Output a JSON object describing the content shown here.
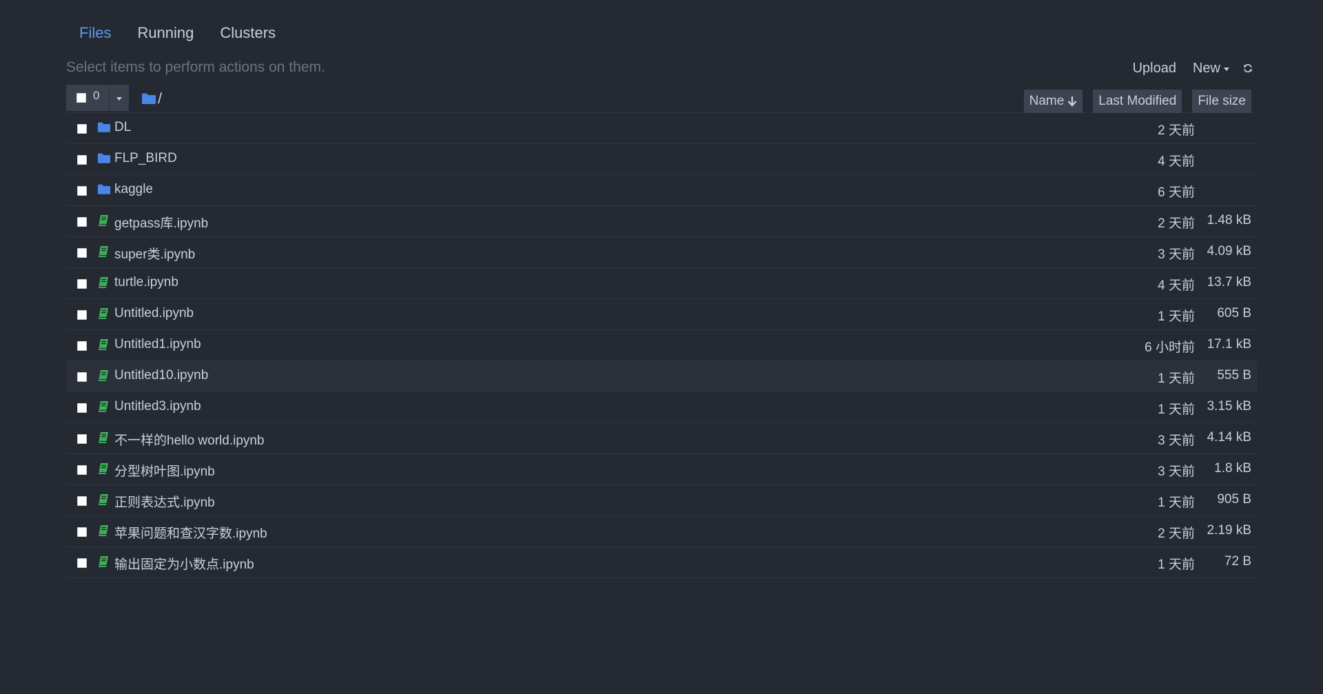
{
  "tabs": [
    {
      "label": "Files",
      "active": true
    },
    {
      "label": "Running",
      "active": false
    },
    {
      "label": "Clusters",
      "active": false
    }
  ],
  "hint": "Select items to perform actions on them.",
  "actions": {
    "upload_label": "Upload",
    "new_label": "New",
    "refresh_icon": "refresh-icon"
  },
  "list_header": {
    "selected_count": "0",
    "breadcrumb_root": "/",
    "sort_name": "Name",
    "sort_last_modified": "Last Modified",
    "sort_file_size": "File size"
  },
  "colors": {
    "background": "#252932",
    "accent": "#5b9bf0",
    "folder": "#4a86e8",
    "notebook": "#3fae5a",
    "text": "#c9ced8",
    "muted": "#6b7484"
  },
  "items": [
    {
      "name": "DL",
      "type": "folder",
      "modified": "2 天前",
      "size": ""
    },
    {
      "name": "FLP_BIRD",
      "type": "folder",
      "modified": "4 天前",
      "size": ""
    },
    {
      "name": "kaggle",
      "type": "folder",
      "modified": "6 天前",
      "size": ""
    },
    {
      "name": "getpass库.ipynb",
      "type": "notebook",
      "modified": "2 天前",
      "size": "1.48 kB"
    },
    {
      "name": "super类.ipynb",
      "type": "notebook",
      "modified": "3 天前",
      "size": "4.09 kB"
    },
    {
      "name": "turtle.ipynb",
      "type": "notebook",
      "modified": "4 天前",
      "size": "13.7 kB"
    },
    {
      "name": "Untitled.ipynb",
      "type": "notebook",
      "modified": "1 天前",
      "size": "605 B"
    },
    {
      "name": "Untitled1.ipynb",
      "type": "notebook",
      "modified": "6 小时前",
      "size": "17.1 kB"
    },
    {
      "name": "Untitled10.ipynb",
      "type": "notebook",
      "modified": "1 天前",
      "size": "555 B"
    },
    {
      "name": "Untitled3.ipynb",
      "type": "notebook",
      "modified": "1 天前",
      "size": "3.15 kB"
    },
    {
      "name": "不一样的hello world.ipynb",
      "type": "notebook",
      "modified": "3 天前",
      "size": "4.14 kB"
    },
    {
      "name": "分型树叶图.ipynb",
      "type": "notebook",
      "modified": "3 天前",
      "size": "1.8 kB"
    },
    {
      "name": "正则表达式.ipynb",
      "type": "notebook",
      "modified": "1 天前",
      "size": "905 B"
    },
    {
      "name": "苹果问题和查汉字数.ipynb",
      "type": "notebook",
      "modified": "2 天前",
      "size": "2.19 kB"
    },
    {
      "name": "输出固定为小数点.ipynb",
      "type": "notebook",
      "modified": "1 天前",
      "size": "72 B"
    }
  ]
}
